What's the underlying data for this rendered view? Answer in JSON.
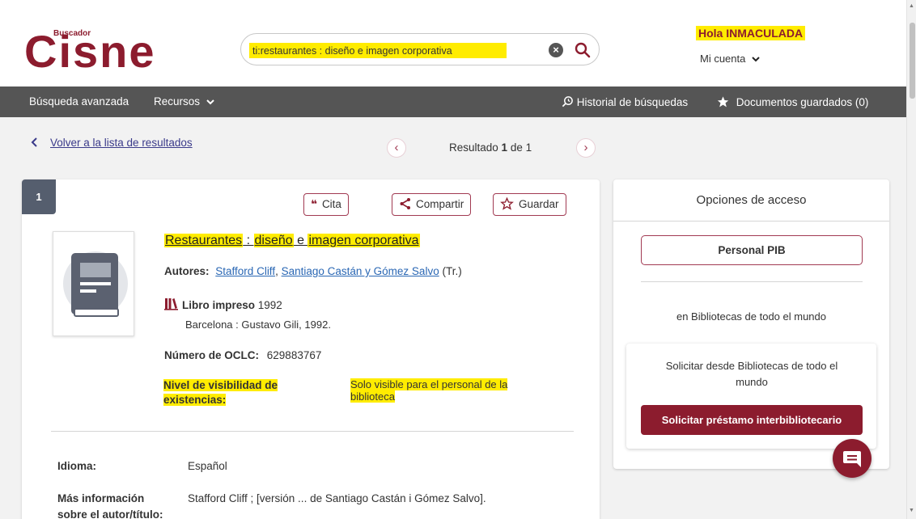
{
  "header": {
    "logo_small": "Buscador",
    "logo_main": "Cisne",
    "search_value": "ti:restaurantes : diseño e imagen corporativa",
    "greeting": "Hola INMACULADA",
    "account_label": "Mi cuenta"
  },
  "nav": {
    "advanced_search": "Búsqueda avanzada",
    "resources": "Recursos",
    "history": "Historial de búsquedas",
    "saved": "Documentos guardados (0)"
  },
  "pager": {
    "back_label": "Volver a la lista de resultados",
    "result_prefix": "Resultado ",
    "current": "1",
    "result_suffix": " de 1"
  },
  "record": {
    "number": "1",
    "actions": {
      "cite": "Cita",
      "share": "Compartir",
      "save": "Guardar"
    },
    "title_parts": [
      "Restaurantes",
      " : ",
      "diseño",
      " e ",
      "imagen corporativa"
    ],
    "authors_label": "Autores:",
    "author1": "Stafford Cliff",
    "author_sep": ", ",
    "author2": "Santiago Castán y Gómez Salvo",
    "author2_role": " (Tr.)",
    "format_label": "Libro impreso",
    "year": " 1992",
    "publisher": "Barcelona : Gustavo Gili, 1992.",
    "oclc_label": "Número de OCLC:",
    "oclc_value": "629883767",
    "visibility_label_1": "Nivel de visibilidad de",
    "visibility_label_2": "existencias:",
    "visibility_value_1": "Solo visible para el personal de la",
    "visibility_value_2": "biblioteca",
    "language_label": "Idioma:",
    "language_value": "Español",
    "more_info_label_1": "Más información",
    "more_info_label_2": "sobre el autor/título:",
    "more_info_value": "Stafford Cliff ; [versión ... de Santiago Castán i Gómez Salvo]."
  },
  "access": {
    "title": "Opciones de acceso",
    "pib_button": "Personal PIB",
    "worldwide_note": "en Bibliotecas de todo el mundo",
    "request_text_1": "Solicitar desde Bibliotecas de todo el",
    "request_text_2": "mundo",
    "ill_button": "Solicitar préstamo interbibliotecario"
  },
  "colors": {
    "brand": "#8c1c2e",
    "navbar": "#555555",
    "highlight": "#ffec00",
    "link": "#2a67b4"
  },
  "icons": [
    "clear-icon",
    "search-icon",
    "chevron-down-icon",
    "history-icon",
    "star-icon",
    "chevron-left-icon",
    "chevron-right-icon",
    "quote-icon",
    "share-icon",
    "star-outline-icon",
    "book-icon",
    "chat-icon"
  ]
}
